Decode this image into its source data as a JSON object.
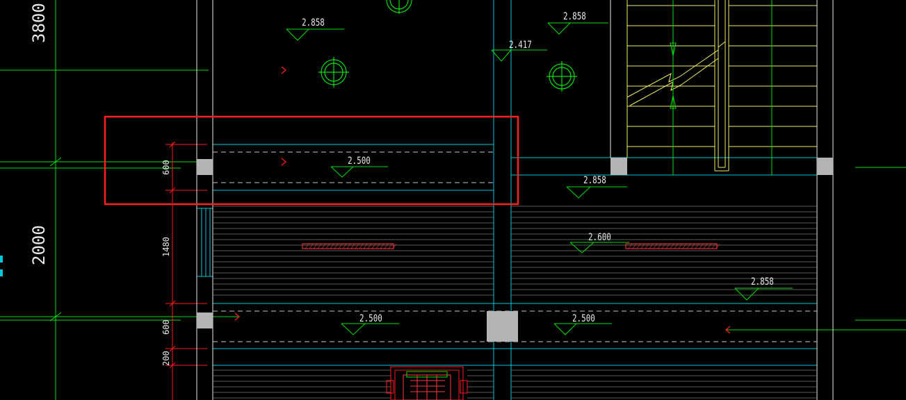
{
  "drawing": {
    "colors": {
      "background": "#000000",
      "cyan": "#00c8d8",
      "green": "#00e000",
      "red": "#ff1a1a",
      "yellow": "#f0f060",
      "white": "#e8e8e8",
      "gray": "#b4b4b4",
      "highlight": "#ff2020"
    },
    "level_marks": [
      {
        "id": "lvl-2858-top-left",
        "text": "2.858"
      },
      {
        "id": "lvl-2858-top-right",
        "text": "2.858"
      },
      {
        "id": "lvl-2417",
        "text": "2.417"
      },
      {
        "id": "lvl-2500-highlight",
        "text": "2.500"
      },
      {
        "id": "lvl-2858-mid",
        "text": "2.858"
      },
      {
        "id": "lvl-2600",
        "text": "2.600"
      },
      {
        "id": "lvl-2858-right",
        "text": "2.858"
      },
      {
        "id": "lvl-2500-bottom-left",
        "text": "2.500"
      },
      {
        "id": "lvl-2500-bottom-right",
        "text": "2.500"
      }
    ],
    "dimensions": {
      "d600_top": "600",
      "d1480": "1480",
      "d600_bottom": "600",
      "d200": "200",
      "big_3800": "3800",
      "big_2000": "2000"
    }
  }
}
